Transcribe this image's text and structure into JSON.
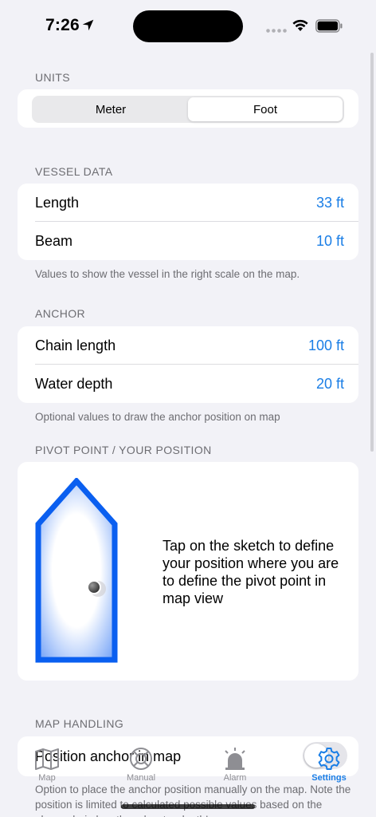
{
  "status_bar": {
    "time": "7:26"
  },
  "units": {
    "header": "UNITS",
    "options": [
      "Meter",
      "Foot"
    ],
    "selected": "Foot"
  },
  "vessel": {
    "header": "VESSEL DATA",
    "rows": [
      {
        "label": "Length",
        "value": "33 ft"
      },
      {
        "label": "Beam",
        "value": "10 ft"
      }
    ],
    "footnote": "Values to show the vessel in the right scale on the map."
  },
  "anchor": {
    "header": "ANCHOR",
    "rows": [
      {
        "label": "Chain length",
        "value": "100 ft"
      },
      {
        "label": "Water depth",
        "value": "20 ft"
      }
    ],
    "footnote": "Optional values to draw the anchor position on map"
  },
  "pivot": {
    "header": "PIVOT POINT / YOUR POSITION",
    "instruction": "Tap on the sketch to define your position where you are to define the pivot point in map view"
  },
  "map_handling": {
    "header": "MAP HANDLING",
    "row_label": "Position anchor in map",
    "toggle_on": false,
    "footnote": "Option to place the anchor position manually on the map. Note the position is limited to calculated possible values based on the above chain length and water depth!"
  },
  "tabs": [
    {
      "label": "Map",
      "icon": "map-icon"
    },
    {
      "label": "Manual",
      "icon": "lifebuoy-icon"
    },
    {
      "label": "Alarm",
      "icon": "alarm-light-icon"
    },
    {
      "label": "Settings",
      "icon": "gear-icon",
      "active": true
    }
  ],
  "colors": {
    "accent": "#1a7ee6",
    "boat_outline": "#0a5ff0",
    "background": "#f2f2f7"
  }
}
